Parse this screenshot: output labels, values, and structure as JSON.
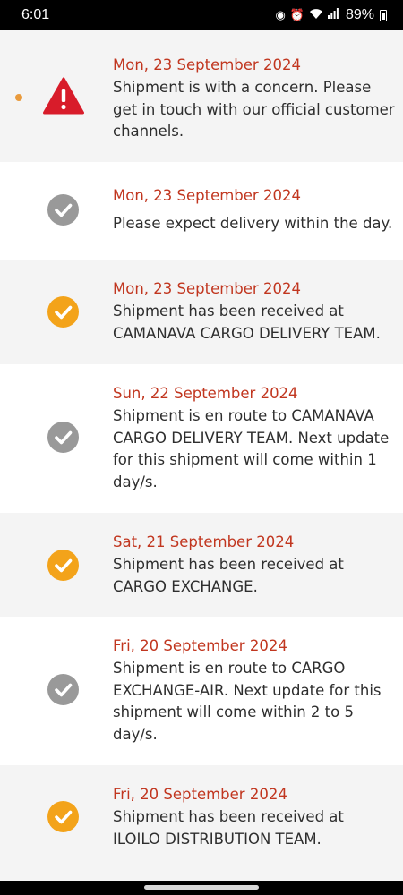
{
  "status_bar": {
    "time": "6:01",
    "battery": "89%",
    "icons": [
      "notification-icon",
      "alarm-icon",
      "wifi-icon",
      "signal-icon",
      "battery-icon"
    ]
  },
  "colors": {
    "date": "#c1361f",
    "text": "#2e2e2e",
    "shaded_row": "#f4f4f4",
    "check_grey": "#999999",
    "check_orange": "#f3a31a",
    "warning_red": "#d81c2a",
    "alert_dot": "#e99a3c"
  },
  "entries": [
    {
      "status": "warning",
      "date": "Mon, 23 September 2024",
      "message": "Shipment is with a concern. Please get in touch with our official customer channels."
    },
    {
      "status": "done-grey",
      "date": "Mon, 23 September 2024",
      "message": "Please expect delivery within the day."
    },
    {
      "status": "done-orange",
      "date": "Mon, 23 September 2024",
      "message": "Shipment has been received at CAMANAVA CARGO DELIVERY TEAM."
    },
    {
      "status": "done-grey",
      "date": "Sun, 22 September 2024",
      "message": "Shipment is en route to CAMANAVA CARGO DELIVERY TEAM. Next update for this shipment will come within 1 day/s."
    },
    {
      "status": "done-orange",
      "date": "Sat, 21 September 2024",
      "message": "Shipment has been received at CARGO EXCHANGE."
    },
    {
      "status": "done-grey",
      "date": "Fri, 20 September 2024",
      "message": "Shipment is en route to CARGO EXCHANGE-AIR. Next update for this shipment will come within 2 to 5 day/s."
    },
    {
      "status": "done-orange",
      "date": "Fri, 20 September 2024",
      "message": "Shipment has been received at ILOILO DISTRIBUTION TEAM."
    }
  ]
}
